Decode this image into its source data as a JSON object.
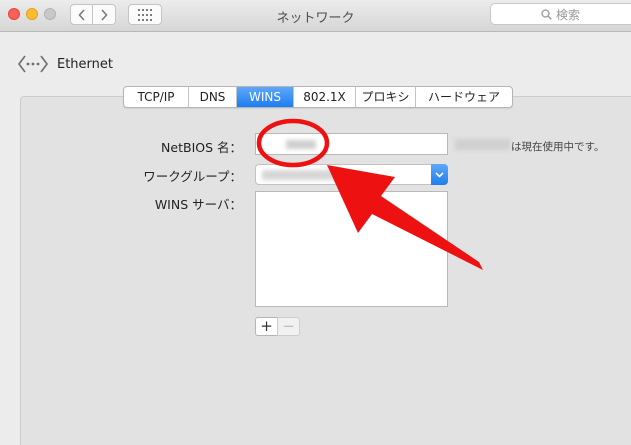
{
  "window": {
    "title": "ネットワーク",
    "search_placeholder": "検索"
  },
  "interface": {
    "name": "Ethernet"
  },
  "tabs": [
    {
      "label": "TCP/IP",
      "active": false
    },
    {
      "label": "DNS",
      "active": false
    },
    {
      "label": "WINS",
      "active": true
    },
    {
      "label": "802.1X",
      "active": false
    },
    {
      "label": "プロキシ",
      "active": false
    },
    {
      "label": "ハードウェア",
      "active": false
    }
  ],
  "form": {
    "netbios_label": "NetBIOS 名：",
    "netbios_status": "は現在使用中です。",
    "workgroup_label": "ワークグループ：",
    "wins_servers_label": "WINS サーバ：",
    "add_label": "+",
    "remove_label": "−"
  },
  "annotation": {
    "color": "#ee1111",
    "shape": "circle-and-arrow"
  },
  "colors": {
    "accent": "#1d7cf2",
    "close": "#fc5f57",
    "minimize": "#fdbc2e",
    "maximize_disabled": "#c8c8c8"
  }
}
